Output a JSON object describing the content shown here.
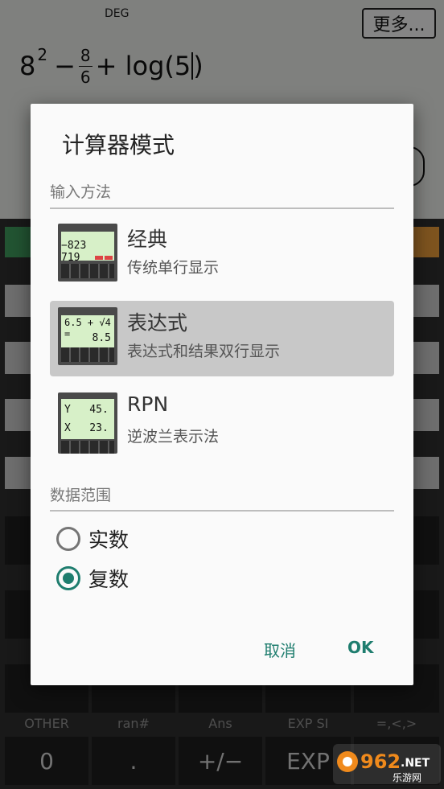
{
  "display": {
    "angle_mode": "DEG",
    "more_label": "更多...",
    "expression": {
      "base": "8",
      "exponent": "2",
      "minus": "−",
      "frac_num": "8",
      "frac_den": "6",
      "plus_log": "+ log(5"
    }
  },
  "keypad": {
    "sublabels": [
      "OTHER",
      "ran#",
      "Ans",
      "EXP SI",
      "=,<,>"
    ],
    "bottom_keys": [
      "0",
      ".",
      "+/−",
      "EXP"
    ]
  },
  "dialog": {
    "title": "计算器模式",
    "input_section": "输入方法",
    "modes": [
      {
        "title": "经典",
        "desc": "传统单行显示",
        "lcd": "−823 719",
        "selected": false
      },
      {
        "title": "表达式",
        "desc": "表达式和结果双行显示",
        "lcd_top": "6.5 + √4 =",
        "lcd_bottom": "8.5",
        "selected": true
      },
      {
        "title": "RPN",
        "desc": "逆波兰表示法",
        "lcd_y": "Y   45.",
        "lcd_x": "X   23.",
        "selected": false
      }
    ],
    "range_section": "数据范围",
    "range_options": [
      {
        "label": "实数",
        "checked": false
      },
      {
        "label": "复数",
        "checked": true
      }
    ],
    "cancel_label": "取消",
    "ok_label": "OK"
  },
  "watermark": {
    "text": "962",
    "suffix": ".NET",
    "subtext": "乐游网"
  },
  "colors": {
    "accent": "#1e7d6e",
    "selected_row": "#c8c8c8",
    "lcd": "#d7f0c8"
  }
}
